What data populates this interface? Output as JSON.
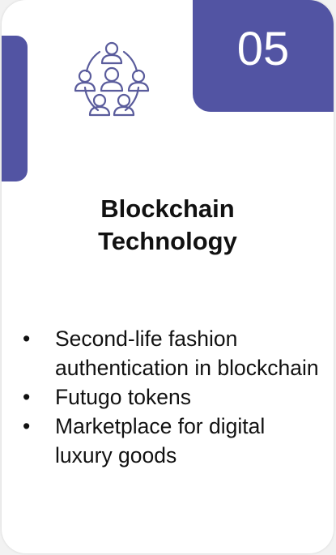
{
  "card": {
    "number": "05",
    "title_line1": "Blockchain",
    "title_line2": "Technology",
    "icon": "people-network-icon",
    "bullet_symbol": "•",
    "bullets": [
      "Second-life fashion authentication in blockchain",
      "Futugo tokens",
      "Marketplace for digital luxury goods"
    ]
  },
  "colors": {
    "accent": "#5254a3",
    "icon_stroke": "#5a5c9c",
    "text": "#111111",
    "card_bg": "#ffffff"
  }
}
